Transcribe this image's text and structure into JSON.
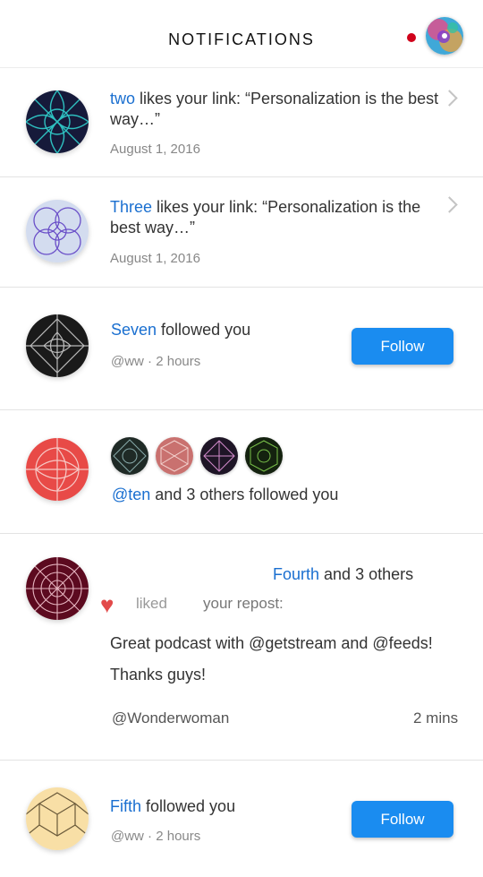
{
  "header": {
    "title": "NOTIFICATIONS",
    "colors": {
      "dot": "#d0021b"
    }
  },
  "notifications": [
    {
      "type": "like",
      "actor": "two",
      "text": " likes your link:  “Personalization is the best way…”",
      "date": "August 1, 2016",
      "avatar_icon": "geometric-pattern-navy-icon"
    },
    {
      "type": "like",
      "actor": "Three",
      "text": " likes your link:  “Personalization is the best way…”",
      "date": "August 1, 2016",
      "avatar_icon": "geometric-pattern-lavender-icon"
    },
    {
      "type": "follow",
      "actor": "Seven",
      "text": " followed you",
      "meta": "@ww · 2 hours",
      "button": "Follow",
      "avatar_icon": "geometric-pattern-black-icon"
    },
    {
      "type": "group-follow",
      "actor": "@ten",
      "text": " and 3 others followed you",
      "mini_avatars": [
        "geometric-pattern-dark-icon",
        "geometric-pattern-rose-icon",
        "geometric-pattern-purple-icon",
        "geometric-pattern-green-icon"
      ],
      "avatar_icon": "geometric-pattern-red-icon"
    },
    {
      "type": "repost-like",
      "actor": "Fourth",
      "text": " and 3 others",
      "liked": "liked",
      "repost": "your repost:",
      "body": "Great podcast with @getstream and @feeds! Thanks guys!",
      "author": "@Wonderwoman",
      "time": "2 mins",
      "avatar_icon": "geometric-pattern-maroon-icon"
    },
    {
      "type": "follow",
      "actor": "Fifth",
      "text": " followed you",
      "meta": "@ww · 2 hours",
      "button": "Follow",
      "avatar_icon": "geometric-pattern-cream-icon"
    }
  ],
  "colors": {
    "link": "#1a6fd0",
    "button": "#1a8cf0",
    "heart": "#e24a4a"
  }
}
